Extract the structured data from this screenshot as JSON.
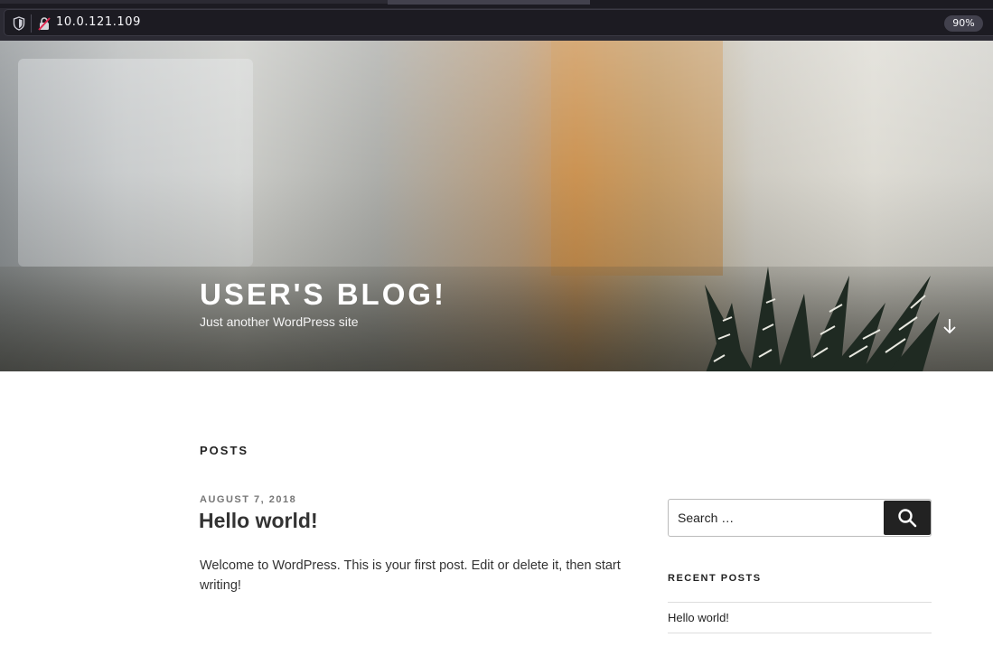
{
  "browser": {
    "url": "10.0.121.109",
    "zoom": "90%"
  },
  "site": {
    "title": "USER'S BLOG!",
    "description": "Just another WordPress site"
  },
  "main": {
    "section_heading": "POSTS",
    "post": {
      "date": "AUGUST 7, 2018",
      "title": "Hello world!",
      "excerpt": "Welcome to WordPress. This is your first post. Edit or delete it, then start writing!"
    }
  },
  "sidebar": {
    "search": {
      "placeholder": "Search …"
    },
    "recent_posts": {
      "heading": "RECENT POSTS",
      "items": [
        "Hello world!"
      ]
    }
  },
  "colors": {
    "chrome_dark": "#2b2a33",
    "urlbar_bg": "#1c1b22",
    "text_dark": "#222222",
    "meta_gray": "#767676"
  }
}
